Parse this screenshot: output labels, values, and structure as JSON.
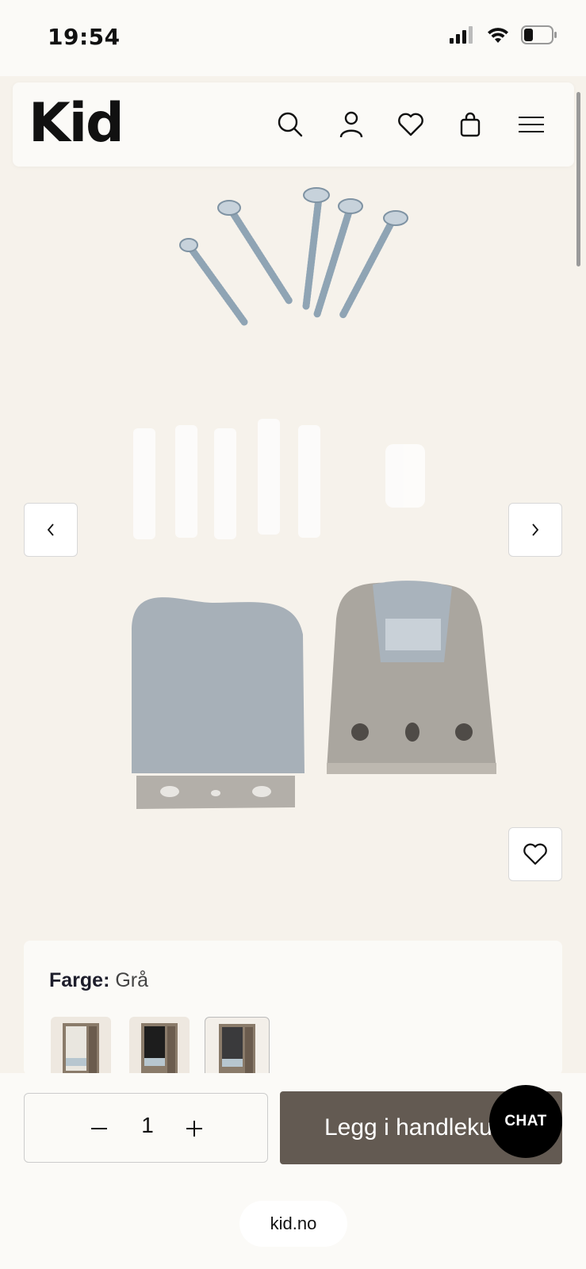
{
  "status_bar": {
    "time": "19:54",
    "icons": [
      "signal-icon",
      "wifi-icon",
      "battery-icon"
    ]
  },
  "header": {
    "logo": "Kid",
    "icons": [
      "search-icon",
      "account-icon",
      "heart-icon",
      "bag-icon",
      "menu-icon"
    ]
  },
  "gallery": {
    "prev_icon": "chevron-left-icon",
    "next_icon": "chevron-right-icon",
    "favorite_icon": "heart-icon"
  },
  "variant": {
    "label": "Farge:",
    "value": "Grå",
    "swatches": [
      "white-roller-blind",
      "dark-roller-blind",
      "grey-roller-blind"
    ],
    "selected_index": 2
  },
  "purchase": {
    "quantity": "1",
    "minus_icon": "minus-icon",
    "plus_icon": "plus-icon",
    "add_to_cart": "Legg i handlekurv",
    "chat": "CHAT"
  },
  "browser": {
    "url": "kid.no"
  },
  "colors": {
    "page_bg": "#f6f2eb",
    "cart_button": "#635a52",
    "chat_button": "#000000"
  }
}
